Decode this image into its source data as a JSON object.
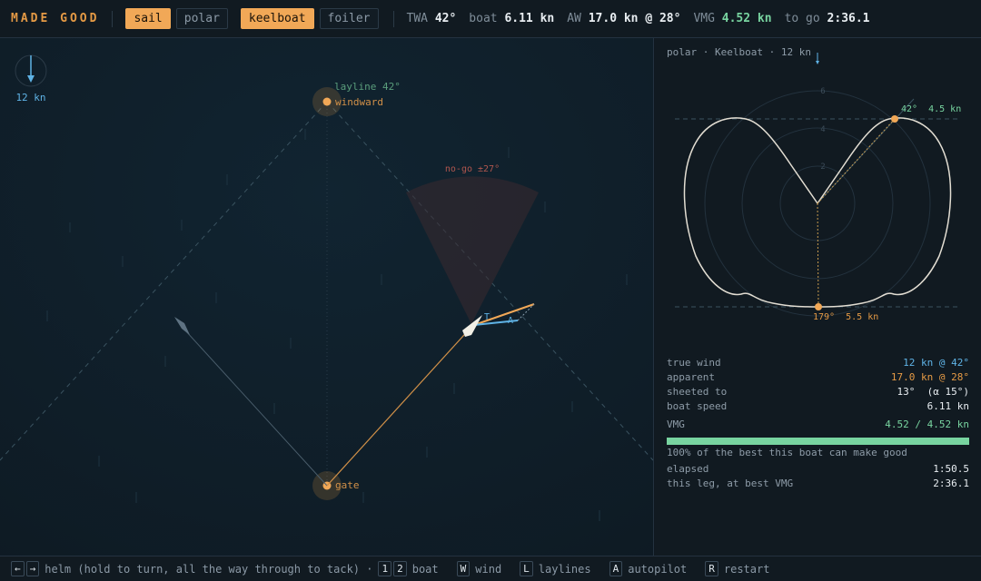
{
  "brand": "MADE GOOD",
  "mode_buttons": [
    {
      "label": "sail",
      "active": true
    },
    {
      "label": "polar",
      "active": false
    }
  ],
  "boat_buttons": [
    {
      "label": "keelboat",
      "active": true
    },
    {
      "label": "foiler",
      "active": false
    }
  ],
  "stats": {
    "twa_label": "TWA",
    "twa_value": "42°",
    "boat_label": "boat",
    "boat_value": "6.11 kn",
    "aw_label": "AW",
    "aw_value": "17.0 kn @ 28°",
    "vmg_label": "VMG",
    "vmg_value": "4.52 kn",
    "togo_label": "to go",
    "togo_value": "2:36.1"
  },
  "map": {
    "wind_speed": "12 kn",
    "layline_label": "layline 42°",
    "windward_label": "windward",
    "gate_label": "gate",
    "nogo_label": "no-go ±27°",
    "vector_t": "T",
    "vector_a": "A"
  },
  "polar": {
    "title": "polar · Keelboat · 12 kn",
    "ring_labels": [
      "2",
      "4",
      "6"
    ],
    "best_up_label": "42°  4.5 kn",
    "best_down_label": "179°  5.5 kn"
  },
  "readout": {
    "true_wind_label": "true wind",
    "true_wind_value": "12 kn @ 42°",
    "apparent_label": "apparent",
    "apparent_value": "17.0 kn @ 28°",
    "sheeted_label": "sheeted to",
    "sheeted_value": "13°  (α 15°)",
    "speed_label": "boat speed",
    "speed_value": "6.11 kn",
    "vmg_label": "VMG",
    "vmg_value": "4.52 / 4.52 kn",
    "vmg_fraction": 1.0,
    "vmg_note": "100% of the best this boat can make good",
    "elapsed_label": "elapsed",
    "elapsed_value": "1:50.5",
    "leg_label": "this leg, at best VMG",
    "leg_value": "2:36.1"
  },
  "help": {
    "keys_helm": [
      "←",
      "→"
    ],
    "helm_text": "helm (hold to turn, all the way through to tack) ·",
    "keys_boat": [
      "1",
      "2"
    ],
    "boat_text": "boat",
    "key_wind": "W",
    "wind_text": "wind",
    "key_laylines": "L",
    "laylines_text": "laylines",
    "key_autopilot": "A",
    "autopilot_text": "autopilot",
    "key_restart": "R",
    "restart_text": "restart"
  },
  "colors": {
    "accent": "#f1a857",
    "green": "#78d4a0",
    "blue": "#5fb3e6",
    "background": "#10202b"
  }
}
